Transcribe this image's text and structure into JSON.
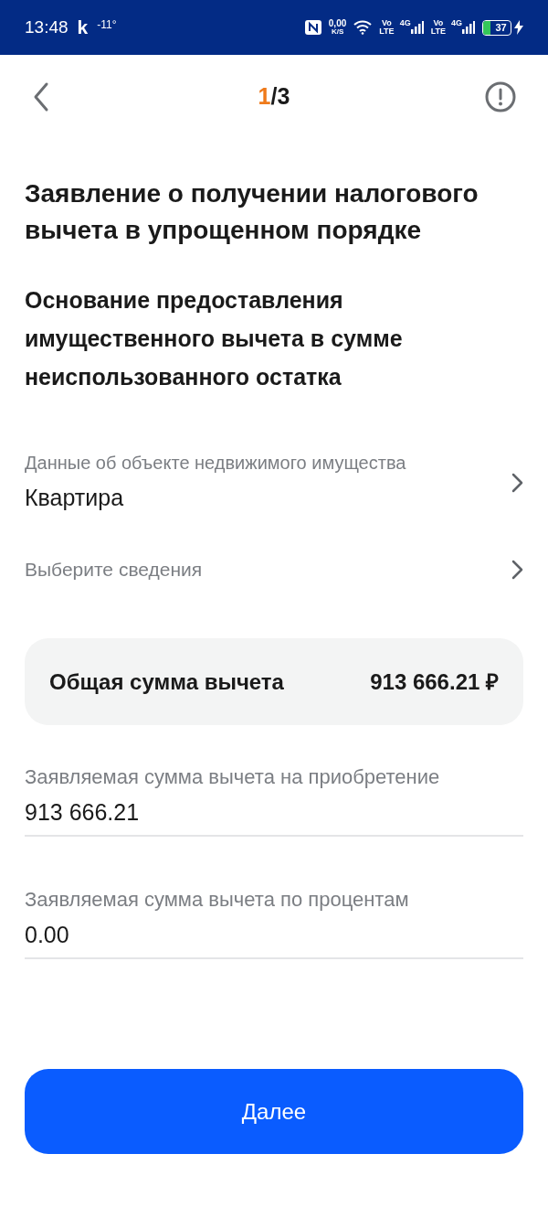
{
  "status_bar": {
    "time": "13:48",
    "logo": "k",
    "temperature": "-11°",
    "net_speed": "0,00",
    "net_unit": "K/S",
    "sim": [
      {
        "volte_top": "Vo",
        "volte_bottom": "LTE",
        "network": "4G"
      },
      {
        "volte_top": "Vo",
        "volte_bottom": "LTE",
        "network": "4G"
      }
    ],
    "battery": "37"
  },
  "header": {
    "step_current": "1",
    "step_total": "/3"
  },
  "title": "Заявление о получении налогового вычета в упрощенном порядке",
  "subtitle": "Основание предоставления имущественного вычета в сумме неиспользованного остатка",
  "selects": [
    {
      "label": "Данные об объекте недвижимого имущества",
      "value": "Квартира"
    },
    {
      "placeholder": "Выберите сведения"
    }
  ],
  "total": {
    "label": "Общая сумма вычета",
    "amount": "913 666.21 ₽"
  },
  "inputs": [
    {
      "label": "Заявляемая сумма вычета на приобретение",
      "value": "913 666.21"
    },
    {
      "label": "Заявляемая сумма вычета по процентам",
      "value": "0.00"
    }
  ],
  "button": "Далее"
}
